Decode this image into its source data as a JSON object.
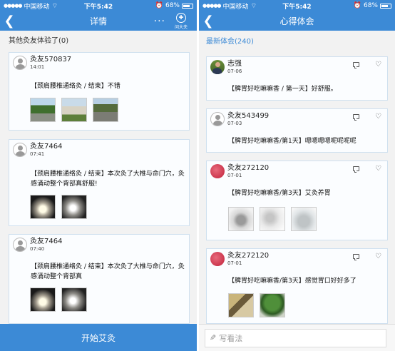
{
  "left": {
    "status": {
      "carrier": "中国移动",
      "time": "下午5:42",
      "battery": "68%"
    },
    "nav": {
      "title": "详情",
      "more": "···",
      "ask_label": "问大夫"
    },
    "section": "其他灸友体验了(0)",
    "cards": [
      {
        "name": "灸友570837",
        "time": "14:01",
        "text": "【颈肩腰椎通络灸 / 结束】不错"
      },
      {
        "name": "灸友7464",
        "time": "07:41",
        "text": "【颈肩腰椎通络灸 / 结束】本次灸了大椎与命门穴，灸感涌动整个背部真舒服!"
      },
      {
        "name": "灸友7464",
        "time": "07:40",
        "text": "【颈肩腰椎通络灸 / 结束】本次灸了大椎与命门穴，灸感涌动整个背部真"
      }
    ],
    "start_button": "开始艾灸"
  },
  "right": {
    "status": {
      "carrier": "中国移动",
      "time": "下午5:42",
      "battery": "68%"
    },
    "nav": {
      "title": "心得体会"
    },
    "section": "最新体会(240)",
    "cards": [
      {
        "name": "志强",
        "time": "07-06",
        "text": "【脾胃好吃嘛嘛香 / 第一天】好舒服。"
      },
      {
        "name": "灸友543499",
        "time": "07-03",
        "text": "【脾胃好吃嘛嘛香/第1天】嗯嗯嗯嗯呢呢呢呢"
      },
      {
        "name": "灸友272120",
        "time": "07-01",
        "text": "【脾胃好吃嘛嘛香/第3天】艾灸养胃"
      },
      {
        "name": "灸友272120",
        "time": "07-01",
        "text": "【脾胃好吃嘛嘛香/第3天】感觉胃口好好多了"
      }
    ],
    "write_placeholder": "写看法"
  },
  "colors": {
    "brand": "#3c8ad6",
    "card_border": "#cfe0ef"
  },
  "icons": {
    "back": "chevron-left-icon",
    "comment": "comment-icon",
    "like": "heart-icon",
    "pen": "pencil-icon"
  }
}
